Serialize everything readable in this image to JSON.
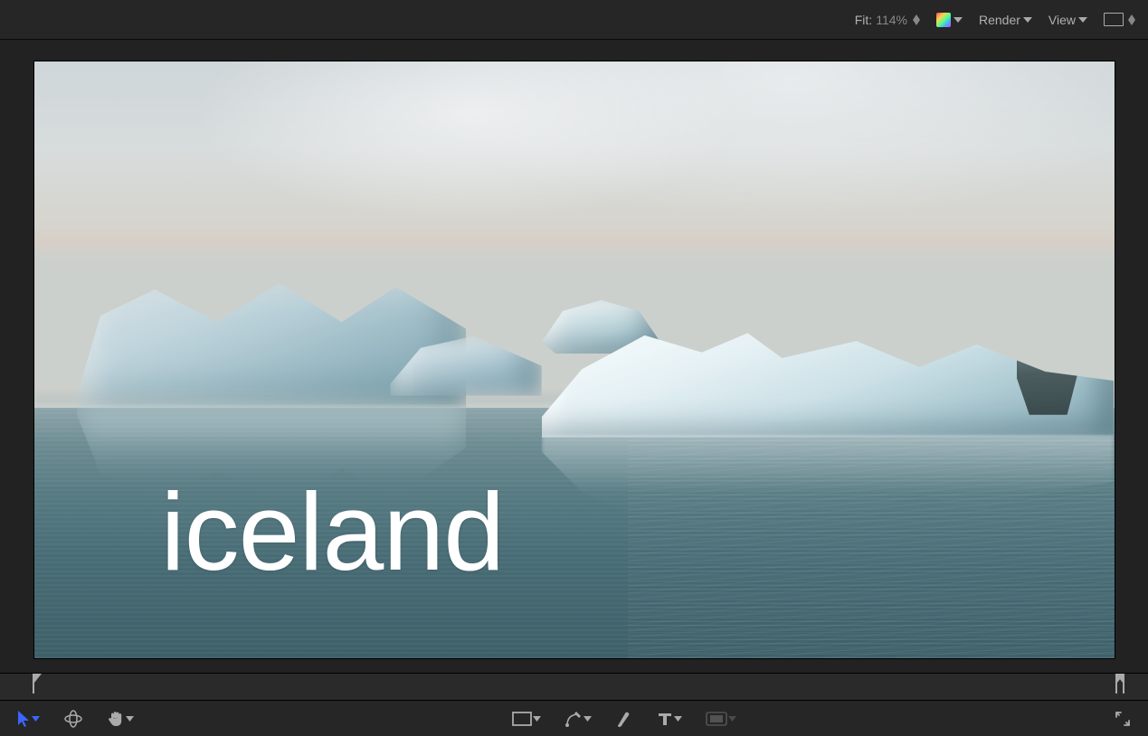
{
  "toolbar": {
    "fit_label": "Fit:",
    "fit_value": "114%",
    "color_channels_label": "Color Channels",
    "render_label": "Render",
    "view_label": "View",
    "aspect_label": "Aspect"
  },
  "canvas": {
    "title_text": "iceland"
  },
  "tools": {
    "arrow": "select-arrow",
    "orbit": "orbit-3d",
    "pan": "pan-hand",
    "rect": "rectangle-tool",
    "pen": "pen-tool",
    "brush": "brush-tool",
    "text": "text-tool",
    "mask": "mask-tool",
    "fullscreen": "fullscreen-toggle"
  }
}
